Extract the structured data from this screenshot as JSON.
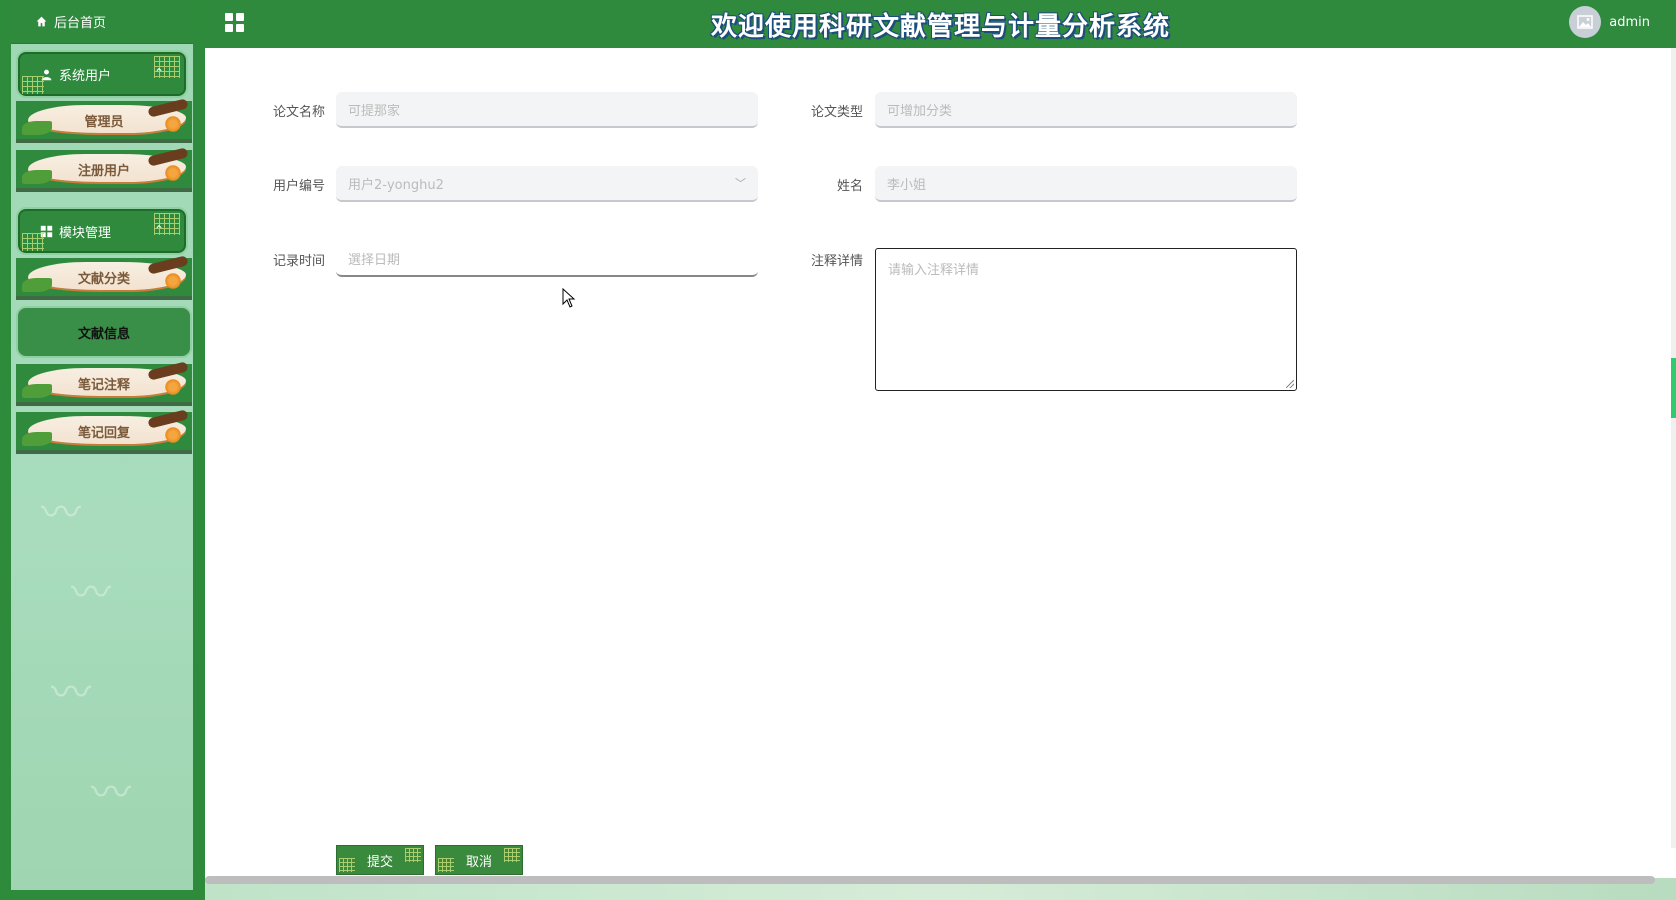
{
  "header": {
    "title": "欢迎使用科研文献管理与计量分析系统",
    "username": "admin"
  },
  "sidebar": {
    "home": "后台首页",
    "groups": [
      {
        "label": "系统用户",
        "items": [
          "管理员",
          "注册用户"
        ]
      },
      {
        "label": "模块管理",
        "items": [
          "文献分类",
          "文献信息",
          "笔记注释",
          "笔记回复"
        ]
      }
    ]
  },
  "form": {
    "fields": [
      {
        "label": "论文名称",
        "placeholder": "可提那家"
      },
      {
        "label": "论文类型",
        "placeholder": "可增加分类"
      },
      {
        "label": "用户编号",
        "placeholder": "用户2-yonghu2"
      },
      {
        "label": "姓名",
        "placeholder": "李小姐"
      },
      {
        "label": "记录时间",
        "placeholder": "選择日期"
      },
      {
        "label": "注释详情",
        "placeholder": "请输入注释详情"
      }
    ],
    "submit": "提交",
    "cancel": "取消"
  },
  "colors": {
    "primary": "#2f8a3e",
    "sidebar_bg": "#a8dcbd"
  }
}
